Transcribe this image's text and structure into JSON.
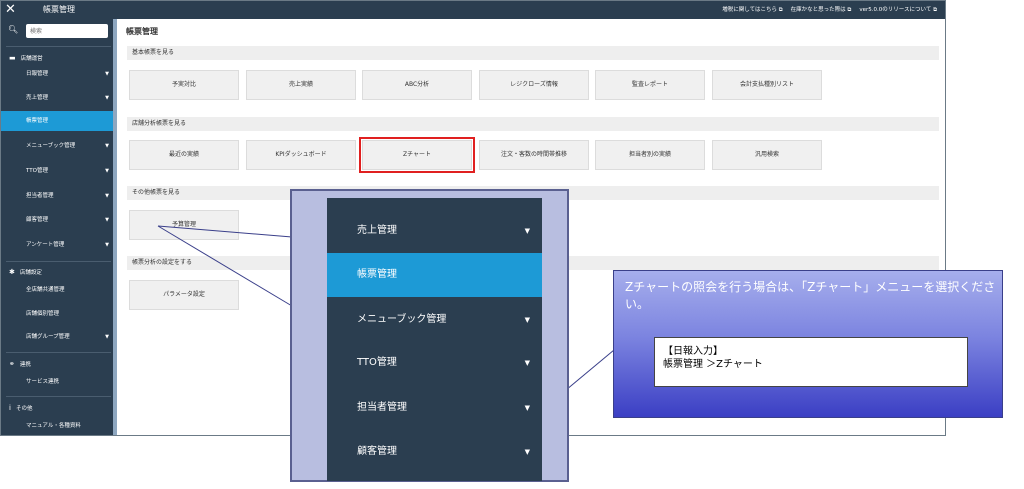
{
  "topbar": {
    "close_icon": "close-icon",
    "title": "帳票管理",
    "links": [
      "増税に関してはこちら ⧉",
      "在庫かなと思った際は ⧉",
      "ver5.0.0のリリースについて ⧉"
    ]
  },
  "sidebar": {
    "search_placeholder": "検索",
    "groups": [
      {
        "label": "店舗運営",
        "icon": "store-icon"
      },
      {
        "label": "店舗設定",
        "icon": "gear-icon"
      },
      {
        "label": "連携",
        "icon": "link-icon"
      },
      {
        "label": "その他",
        "icon": "info-icon"
      }
    ],
    "items": [
      "日報管理",
      "売上管理",
      "帳票管理",
      "メニューブック管理",
      "TTO管理",
      "担当者管理",
      "顧客管理",
      "アンケート管理"
    ],
    "settings_items": [
      "全店舗共通管理",
      "店舗個別管理",
      "店舗グループ管理"
    ],
    "link_items": [
      "サービス連携"
    ],
    "other_items": [
      "マニュアル・各種資料"
    ]
  },
  "main": {
    "title": "帳票管理",
    "sections": [
      {
        "label": "基本帳票を見る",
        "buttons": [
          "予実対比",
          "売上実績",
          "ABC分析",
          "レジクローズ情報",
          "監査レポート",
          "会計支払種別リスト"
        ]
      },
      {
        "label": "店舗分析帳票を見る",
        "buttons": [
          "最近の実績",
          "KPIダッシュボード",
          "Zチャート",
          "注文・客数の時間帯推移",
          "担当者別の実績",
          "汎用検索"
        ]
      },
      {
        "label": "その他帳票を見る",
        "buttons": [
          "予算管理"
        ]
      },
      {
        "label": "帳票分析の設定をする",
        "buttons": [
          "パラメータ設定"
        ]
      }
    ]
  },
  "zoom_menu": {
    "items": [
      "売上管理",
      "帳票管理",
      "メニューブック管理",
      "TTO管理",
      "担当者管理",
      "顧客管理"
    ]
  },
  "callout": {
    "message": "Zチャートの照会を行う場合は、「Zチャート」メニューを選択ください。",
    "box_line1": "【日報入力】",
    "box_line2": "帳票管理 ＞Zチャート"
  },
  "colors": {
    "sidebar_bg": "#2b3e50",
    "active": "#1d9ad6",
    "highlight": "#e02020",
    "callout_dark": "#3b3fc4"
  }
}
